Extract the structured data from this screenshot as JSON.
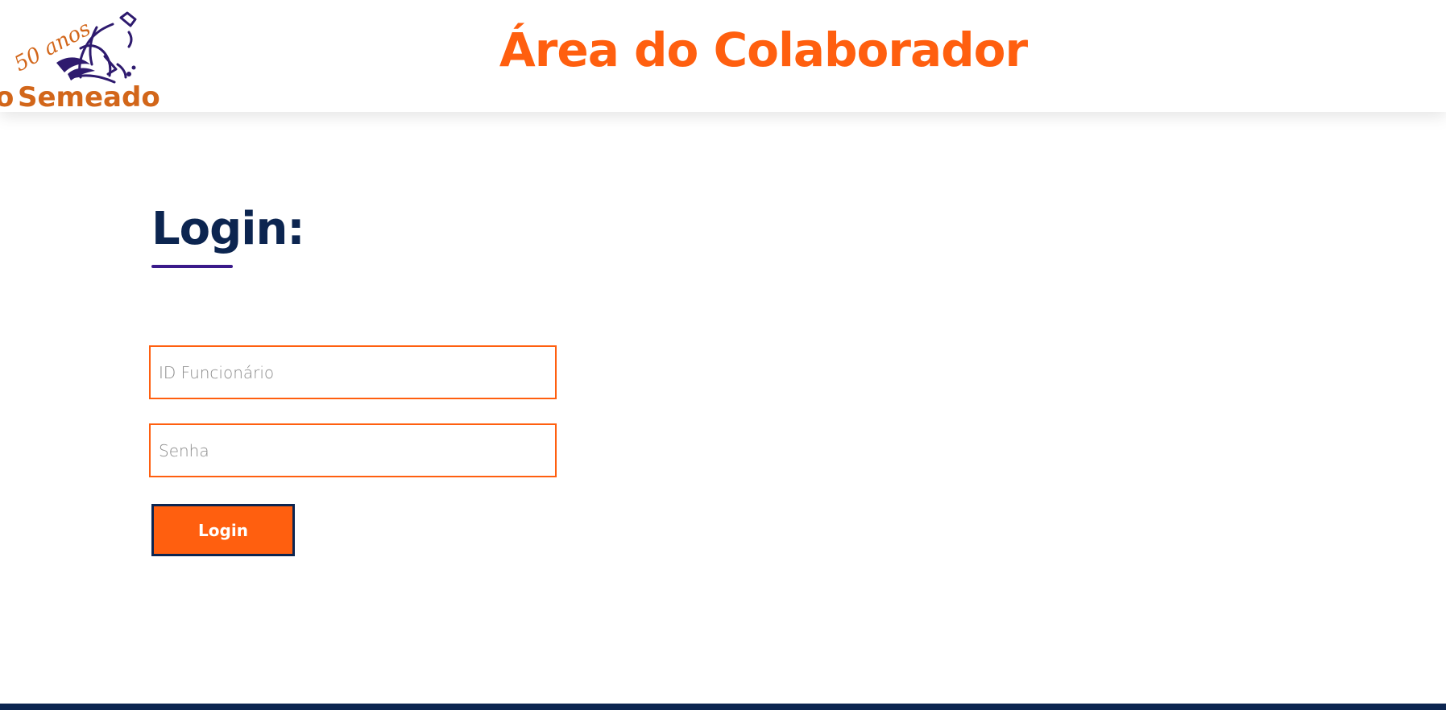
{
  "header": {
    "logo": {
      "anniversary_text": "50 anos",
      "brand_prefix": "o",
      "brand_name": "Semeador",
      "icon": "sower-figure-icon"
    },
    "title": "Área do Colaborador"
  },
  "login": {
    "heading": "Login:",
    "employee_id": {
      "placeholder": "ID Funcionário",
      "value": ""
    },
    "password": {
      "placeholder": "Senha",
      "value": ""
    },
    "submit_label": "Login"
  },
  "colors": {
    "accent_orange": "#ff5f0f",
    "navy": "#0c2550",
    "underline_purple": "#3a1a8a",
    "logo_purple": "#2e1a6e"
  }
}
